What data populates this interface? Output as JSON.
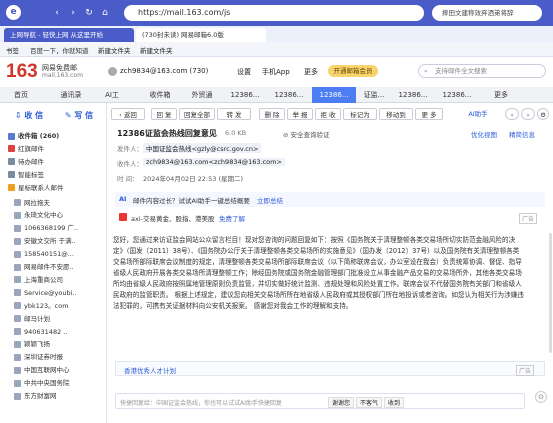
{
  "browser": {
    "url": "https://mail.163.com/js",
    "search_text": "摔田文建称效弃洒弟将辞",
    "bookmarks": [
      "书签",
      "百度一下，你就知道",
      "新建文件夹",
      "新建文件夹"
    ],
    "tabs": [
      "上网导航 - 轻快上网 从这里开始",
      "(730封未读) 网易邮箱6.0版"
    ]
  },
  "app": {
    "logo_num": "163",
    "logo_text": "网易免费邮",
    "logo_sub": "mail.163.com",
    "account": "zch9834@163.com (730)",
    "links": [
      "设置",
      "手机App",
      "更多"
    ],
    "vip": "开通邮箱会员",
    "search_placeholder": "支持邮件全文搜索"
  },
  "nav": {
    "tabs": [
      "首页",
      "通讯录",
      "AI工",
      "收件箱",
      "外贸通",
      "12386...",
      "12386...",
      "12386...",
      "证监...",
      "12386...",
      "12386...",
      "更多"
    ]
  },
  "sidebar": {
    "receive": "收 信",
    "write": "写 信",
    "items": [
      {
        "label": "收件箱 (260)",
        "icon": "inbox-icon"
      },
      {
        "label": "红旗邮件",
        "icon": "flag-icon"
      },
      {
        "label": "待办邮件",
        "icon": "todo-icon"
      },
      {
        "label": "智能标签",
        "icon": "tag-icon"
      },
      {
        "label": "星标联系人邮件",
        "icon": "star-icon"
      },
      {
        "label": "网拉拖夫",
        "icon": "contact-icon"
      },
      {
        "label": "永琦文化中心",
        "icon": "contact-icon"
      },
      {
        "label": "1066368199 广..",
        "icon": "contact-icon"
      },
      {
        "label": "安徽文交所 于满..",
        "icon": "contact-icon"
      },
      {
        "label": "158540151@...",
        "icon": "contact-icon"
      },
      {
        "label": "网易邮件不安愿..",
        "icon": "contact-icon"
      },
      {
        "label": "上海重商公司",
        "icon": "contact-icon"
      },
      {
        "label": "Service@youbi..",
        "icon": "contact-icon"
      },
      {
        "label": "ybk123。com",
        "icon": "contact-icon"
      },
      {
        "label": "邮马计划",
        "icon": "contact-icon"
      },
      {
        "label": "940631482 ..",
        "icon": "contact-icon"
      },
      {
        "label": "颖颖飞扬",
        "icon": "contact-icon"
      },
      {
        "label": "深圳证券时报",
        "icon": "contact-icon"
      },
      {
        "label": "中国互联网中心",
        "icon": "contact-icon"
      },
      {
        "label": "中共中央国务院",
        "icon": "contact-icon"
      },
      {
        "label": "东方财富网",
        "icon": "contact-icon"
      }
    ]
  },
  "toolbar": {
    "back": "返回",
    "buttons": [
      "回 复",
      "回复全部",
      "转 发",
      "删 除",
      "举 报",
      "拒 收",
      "标记为",
      "移动到",
      "更 多"
    ],
    "ai_assist": "AI助手"
  },
  "mail": {
    "subject": "12386证监会热线回复意见",
    "size": "6.0 KB",
    "security": "安全查询验证",
    "right_links": [
      "优化视图",
      "精简信息"
    ],
    "from_label": "发件人：",
    "from": "中国证监会热线<gzly@csrc.gov.cn>",
    "to_label": "收件人：",
    "to": "zch9834@163.com<zch9834@163.com>",
    "time_label": "时 间：",
    "time": "2024年04月02日 22:53 (星期二)",
    "ai_tip": "邮件内容过长？试试AI助手一键总结概要",
    "ai_link": "立即总结",
    "ad_text": "axi-交易黄金、股指、港美股",
    "ad_link": "免费了解",
    "ad_label": "广告",
    "body": "您好，您通过来访证监会网站公众留言栏目！现对您咨询的问题回复如下：按照《国务院关于清理整顿各类交易场所切实防范金融风险的决定》（国发〔2011〕38号）、《国务院办公厅关于清理整顿各类交易场所的实施意见》（国办发〔2012〕37号）以及国务院有关清理整顿各类交易场所部际联席会议制度的规定，清理整顿各类交易场所部际联席会议（以下简称联席会议，办公室设在我会）负责统筹协调、督促、指导省级人民政府开展各类交易场所清理整顿工作；除经国务院或国务院金融管理部门批准设立从事金融产品交易的交易场所外，其他各类交易场所均由省级人民政府按照属地管理原则负责监管，并切实做好统计监测、违规处理和风险处置工作。联席会议不代替国务院有关部门和省级人民政府的监管职责。 根据上述规定，建议您向相关交易场所所在地省级人民政府或其授权部门所在地投诉或者咨询。如您认为相关行为涉嫌违法犯罪的，可携有关证据材料向公安机关报案。 感谢您对我会工作的理解和支持。",
    "footer_ad": "香港优秀人才计划",
    "reply_placeholder": "快捷回复给：中国证监会热线，你也可以试试AI助手快捷回复",
    "quick_replies": [
      "谢谢您",
      "不客气",
      "收到"
    ]
  }
}
